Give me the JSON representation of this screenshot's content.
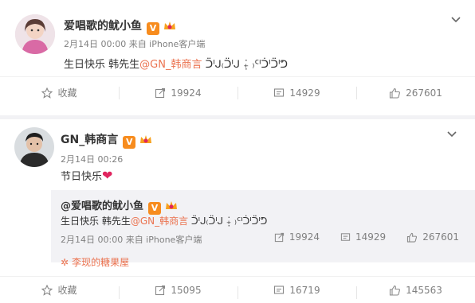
{
  "post1": {
    "author": "爱唱歌的鱿小鱼",
    "verified_badge": "V",
    "meta": "2月14日 00:00 来自 iPhone客户端",
    "content_prefix": "生日快乐 韩先生",
    "mention": "@GN_韩商言",
    "content_suffix": " ᑒᑊᒍ₍ᑒᑊᒍ ₊̣̇ ₎ᑦᑊᑑᑊᑒᑊᕤ",
    "actions": {
      "favorite": "收藏",
      "repost": "19924",
      "comment": "14929",
      "like": "267601"
    }
  },
  "post2": {
    "author": "GN_韩商言",
    "verified_badge": "V",
    "meta": "2月14日 00:26",
    "content": "节日快乐",
    "emoji": "❤",
    "repost": {
      "author": "@爱唱歌的鱿小鱼",
      "verified_badge": "V",
      "content_prefix": "生日快乐 韩先生",
      "mention": "@GN_韩商言",
      "content_suffix": " ᑒᑊᒍ₍ᑒᑊᒍ ₊̣̇ ₎ᑦᑊᑑᑊᑒᑊᕤ",
      "meta": "2月14日 00:00 来自 iPhone客户端",
      "repost_count": "19924",
      "comment_count": "14929",
      "like_count": "267601"
    },
    "source": "李现的糖果屋",
    "actions": {
      "favorite": "收藏",
      "repost": "15095",
      "comment": "16719",
      "like": "145563"
    }
  },
  "colors": {
    "accent": "#eb7350",
    "badge": "#f78c1e",
    "heart": "#e0245e",
    "muted": "#808080"
  }
}
